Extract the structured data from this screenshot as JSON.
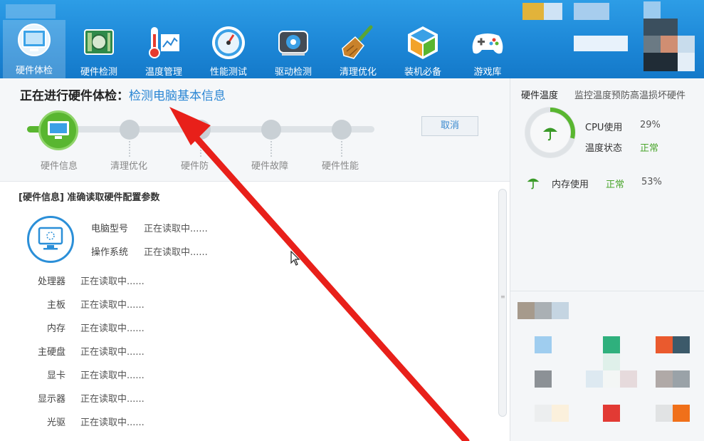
{
  "toolbar": {
    "items": [
      {
        "label": "硬件体检",
        "icon": "monitor-check-icon",
        "active": true
      },
      {
        "label": "硬件检测",
        "icon": "circuit-board-icon",
        "active": false
      },
      {
        "label": "温度管理",
        "icon": "thermometer-icon",
        "active": false
      },
      {
        "label": "性能测试",
        "icon": "speedometer-icon",
        "active": false
      },
      {
        "label": "驱动检测",
        "icon": "gear-chip-icon",
        "active": false
      },
      {
        "label": "清理优化",
        "icon": "broom-icon",
        "active": false
      },
      {
        "label": "装机必备",
        "icon": "cube-icon",
        "active": false
      },
      {
        "label": "游戏库",
        "icon": "gamepad-icon",
        "active": false
      }
    ]
  },
  "header": {
    "title": "正在进行硬件体检：",
    "subtitle": "检测电脑基本信息",
    "cancel_label": "取消"
  },
  "steps": [
    {
      "label": "硬件信息",
      "icon": "monitor-icon"
    },
    {
      "label": "清理优化",
      "icon": "clean-icon"
    },
    {
      "label": "硬件防",
      "icon": "shield-icon"
    },
    {
      "label": "硬件故障",
      "icon": "fault-icon"
    },
    {
      "label": "硬件性能",
      "icon": "performance-icon"
    }
  ],
  "progress": 0.08,
  "section": {
    "title": "[硬件信息] 准确读取硬件配置参数"
  },
  "computer": {
    "model_label": "电脑型号",
    "model_value": "正在读取中......",
    "os_label": "操作系统",
    "os_value": "正在读取中......"
  },
  "hardware": [
    {
      "label": "处理器",
      "value": "正在读取中......"
    },
    {
      "label": "主板",
      "value": "正在读取中......"
    },
    {
      "label": "内存",
      "value": "正在读取中......"
    },
    {
      "label": "主硬盘",
      "value": "正在读取中......"
    },
    {
      "label": "显卡",
      "value": "正在读取中......"
    },
    {
      "label": "显示器",
      "value": "正在读取中......"
    },
    {
      "label": "光驱",
      "value": "正在读取中......"
    }
  ],
  "right_panel": {
    "title": "硬件温度",
    "subtitle": "监控温度预防高温损坏硬件",
    "cpu_label": "CPU使用",
    "cpu_value": "29%",
    "cpu_usage": 0.29,
    "temp_label": "温度状态",
    "temp_value": "正常",
    "mem_label": "内存使用",
    "mem_status": "正常",
    "mem_value": "53%"
  },
  "colors": {
    "toolbar_blue": "#1c86d6",
    "accent_blue": "#2a86d4",
    "ok_green": "#4aa52c",
    "progress_green": "#59b630",
    "arrow_red": "#e8201a"
  }
}
